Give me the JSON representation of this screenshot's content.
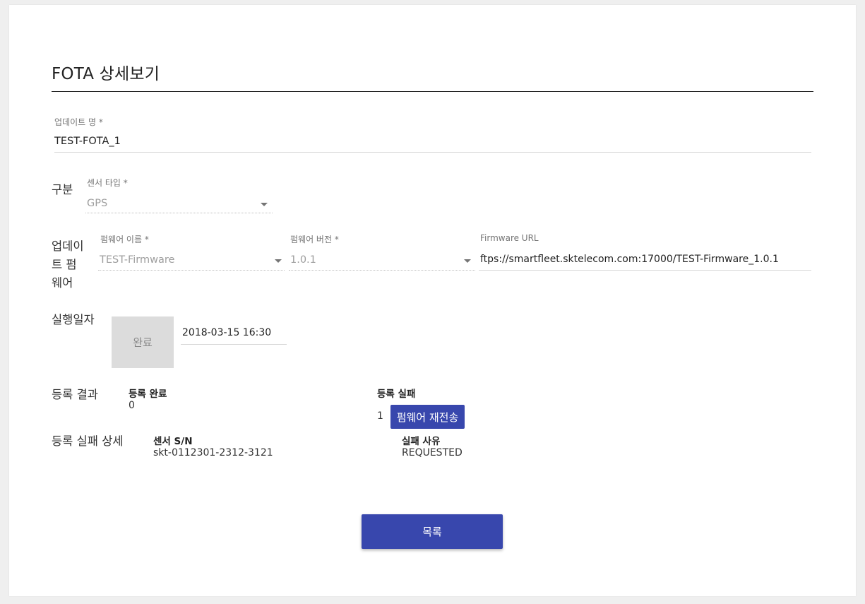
{
  "page": {
    "title": "FOTA 상세보기"
  },
  "update_name": {
    "label": "업데이트 명 *",
    "value": "TEST-FOTA_1"
  },
  "category": {
    "row_label": "구분",
    "sensor_type": {
      "label": "센서 타입 *",
      "value": "GPS"
    }
  },
  "firmware": {
    "row_label_lines": [
      "업데이",
      "트 펌",
      "웨어"
    ],
    "name": {
      "label": "펌웨어 이름 *",
      "value": "TEST-Firmware"
    },
    "version": {
      "label": "펌웨어 버전 *",
      "value": "1.0.1"
    },
    "url": {
      "label": "Firmware URL",
      "value": "ftps://smartfleet.sktelecom.com:17000/TEST-Firmware_1.0.1"
    }
  },
  "execution": {
    "row_label": "실행일자",
    "status": "완료",
    "datetime": "2018-03-15 16:30"
  },
  "result": {
    "row_label": "등록 결과",
    "success": {
      "label": "등록 완료",
      "count": "0"
    },
    "failure": {
      "label": "등록 실패",
      "count": "1"
    },
    "resend_button": "펌웨어 재전송"
  },
  "failure_detail": {
    "row_label": "등록 실패 상세",
    "sensor_sn": {
      "label": "센서 S/N",
      "value": "skt-0112301-2312-3121"
    },
    "reason": {
      "label": "실패 사유",
      "value": "REQUESTED"
    }
  },
  "footer": {
    "list_button": "목록"
  },
  "colors": {
    "primary": "#3847ad",
    "disabled_box": "#dcdcdc",
    "background": "#efefef"
  },
  "icons": {
    "dropdown": "caret-down-icon"
  }
}
